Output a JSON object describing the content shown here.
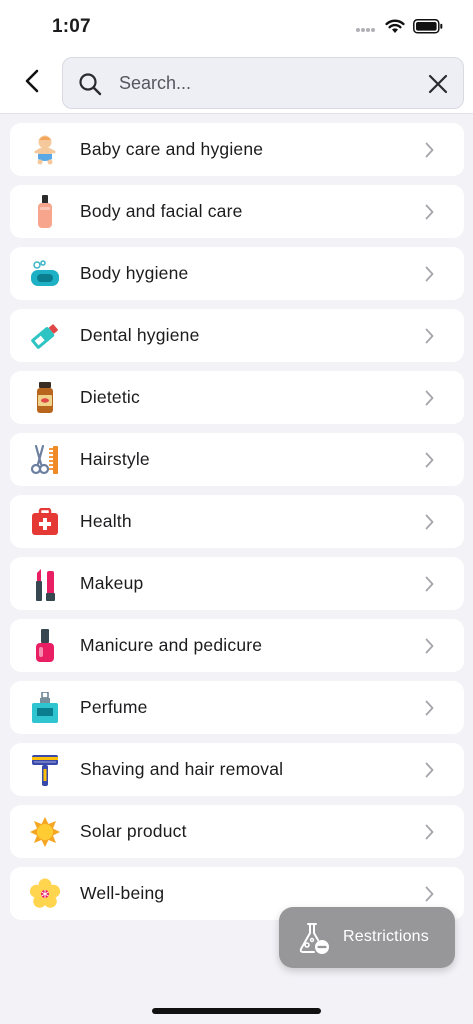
{
  "status_bar": {
    "time": "1:07",
    "signal_icon": "signal-dots-icon",
    "wifi_icon": "wifi-icon",
    "battery_icon": "battery-icon"
  },
  "header": {
    "back_icon": "chevron-left-icon",
    "search": {
      "placeholder": "Search...",
      "value": "",
      "search_icon": "magnifier-icon",
      "clear_icon": "close-icon"
    }
  },
  "categories": [
    {
      "label": "Baby care and hygiene",
      "icon": "baby-icon"
    },
    {
      "label": "Body and facial care",
      "icon": "cream-bottle-icon"
    },
    {
      "label": "Body hygiene",
      "icon": "soap-icon"
    },
    {
      "label": "Dental hygiene",
      "icon": "toothpaste-icon"
    },
    {
      "label": "Dietetic",
      "icon": "supplement-jar-icon"
    },
    {
      "label": "Hairstyle",
      "icon": "scissors-comb-icon"
    },
    {
      "label": "Health",
      "icon": "first-aid-icon"
    },
    {
      "label": "Makeup",
      "icon": "lipstick-icon"
    },
    {
      "label": "Manicure and pedicure",
      "icon": "nail-polish-icon"
    },
    {
      "label": "Perfume",
      "icon": "perfume-icon"
    },
    {
      "label": "Shaving and hair removal",
      "icon": "razor-icon"
    },
    {
      "label": "Solar product",
      "icon": "sun-icon"
    },
    {
      "label": "Well-being",
      "icon": "flower-icon"
    }
  ],
  "restrictions_button": {
    "label": "Restrictions",
    "icon": "flask-minus-icon"
  },
  "colors": {
    "background": "#f2f2f7",
    "card": "#ffffff",
    "search_field": "#eeeef5",
    "fab": "#97979a"
  }
}
